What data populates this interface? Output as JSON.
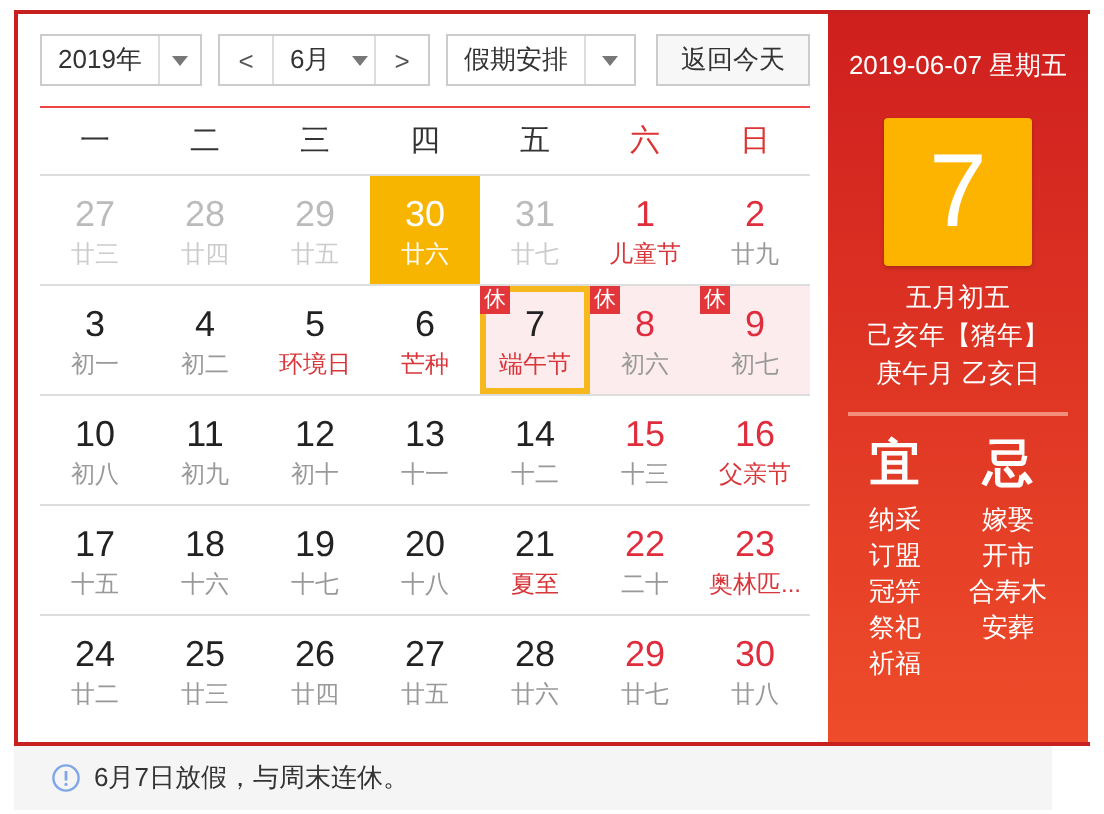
{
  "toolbar": {
    "year": "2019年",
    "prev": "<",
    "month": "6月",
    "next": ">",
    "holiday": "假期安排",
    "today_button": "返回今天"
  },
  "calendar": {
    "weekdays": [
      {
        "label": "一",
        "weekend": false
      },
      {
        "label": "二",
        "weekend": false
      },
      {
        "label": "三",
        "weekend": false
      },
      {
        "label": "四",
        "weekend": false
      },
      {
        "label": "五",
        "weekend": false
      },
      {
        "label": "六",
        "weekend": true
      },
      {
        "label": "日",
        "weekend": true
      }
    ],
    "days": [
      {
        "day": "27",
        "lunar": "廿三",
        "other_month": true,
        "weekend": false,
        "festival": false,
        "highlighted": false,
        "selected": false,
        "rest": false
      },
      {
        "day": "28",
        "lunar": "廿四",
        "other_month": true,
        "weekend": false,
        "festival": false,
        "highlighted": false,
        "selected": false,
        "rest": false
      },
      {
        "day": "29",
        "lunar": "廿五",
        "other_month": true,
        "weekend": false,
        "festival": false,
        "highlighted": false,
        "selected": false,
        "rest": false
      },
      {
        "day": "30",
        "lunar": "廿六",
        "other_month": true,
        "weekend": false,
        "festival": false,
        "highlighted": true,
        "selected": false,
        "rest": false
      },
      {
        "day": "31",
        "lunar": "廿七",
        "other_month": true,
        "weekend": false,
        "festival": false,
        "highlighted": false,
        "selected": false,
        "rest": false
      },
      {
        "day": "1",
        "lunar": "儿童节",
        "other_month": false,
        "weekend": true,
        "festival": true,
        "highlighted": false,
        "selected": false,
        "rest": false
      },
      {
        "day": "2",
        "lunar": "廿九",
        "other_month": false,
        "weekend": true,
        "festival": false,
        "highlighted": false,
        "selected": false,
        "rest": false
      },
      {
        "day": "3",
        "lunar": "初一",
        "other_month": false,
        "weekend": false,
        "festival": false,
        "highlighted": false,
        "selected": false,
        "rest": false
      },
      {
        "day": "4",
        "lunar": "初二",
        "other_month": false,
        "weekend": false,
        "festival": false,
        "highlighted": false,
        "selected": false,
        "rest": false
      },
      {
        "day": "5",
        "lunar": "环境日",
        "other_month": false,
        "weekend": false,
        "festival": true,
        "highlighted": false,
        "selected": false,
        "rest": false
      },
      {
        "day": "6",
        "lunar": "芒种",
        "other_month": false,
        "weekend": false,
        "festival": true,
        "highlighted": false,
        "selected": false,
        "rest": false
      },
      {
        "day": "7",
        "lunar": "端午节",
        "other_month": false,
        "weekend": false,
        "festival": true,
        "highlighted": false,
        "selected": true,
        "rest": true,
        "badge": "休"
      },
      {
        "day": "8",
        "lunar": "初六",
        "other_month": false,
        "weekend": true,
        "festival": false,
        "highlighted": false,
        "selected": false,
        "rest": true,
        "badge": "休"
      },
      {
        "day": "9",
        "lunar": "初七",
        "other_month": false,
        "weekend": true,
        "festival": false,
        "highlighted": false,
        "selected": false,
        "rest": true,
        "badge": "休"
      },
      {
        "day": "10",
        "lunar": "初八",
        "other_month": false,
        "weekend": false,
        "festival": false,
        "highlighted": false,
        "selected": false,
        "rest": false
      },
      {
        "day": "11",
        "lunar": "初九",
        "other_month": false,
        "weekend": false,
        "festival": false,
        "highlighted": false,
        "selected": false,
        "rest": false
      },
      {
        "day": "12",
        "lunar": "初十",
        "other_month": false,
        "weekend": false,
        "festival": false,
        "highlighted": false,
        "selected": false,
        "rest": false
      },
      {
        "day": "13",
        "lunar": "十一",
        "other_month": false,
        "weekend": false,
        "festival": false,
        "highlighted": false,
        "selected": false,
        "rest": false
      },
      {
        "day": "14",
        "lunar": "十二",
        "other_month": false,
        "weekend": false,
        "festival": false,
        "highlighted": false,
        "selected": false,
        "rest": false
      },
      {
        "day": "15",
        "lunar": "十三",
        "other_month": false,
        "weekend": true,
        "festival": false,
        "highlighted": false,
        "selected": false,
        "rest": false
      },
      {
        "day": "16",
        "lunar": "父亲节",
        "other_month": false,
        "weekend": true,
        "festival": true,
        "highlighted": false,
        "selected": false,
        "rest": false
      },
      {
        "day": "17",
        "lunar": "十五",
        "other_month": false,
        "weekend": false,
        "festival": false,
        "highlighted": false,
        "selected": false,
        "rest": false
      },
      {
        "day": "18",
        "lunar": "十六",
        "other_month": false,
        "weekend": false,
        "festival": false,
        "highlighted": false,
        "selected": false,
        "rest": false
      },
      {
        "day": "19",
        "lunar": "十七",
        "other_month": false,
        "weekend": false,
        "festival": false,
        "highlighted": false,
        "selected": false,
        "rest": false
      },
      {
        "day": "20",
        "lunar": "十八",
        "other_month": false,
        "weekend": false,
        "festival": false,
        "highlighted": false,
        "selected": false,
        "rest": false
      },
      {
        "day": "21",
        "lunar": "夏至",
        "other_month": false,
        "weekend": false,
        "festival": true,
        "highlighted": false,
        "selected": false,
        "rest": false
      },
      {
        "day": "22",
        "lunar": "二十",
        "other_month": false,
        "weekend": true,
        "festival": false,
        "highlighted": false,
        "selected": false,
        "rest": false
      },
      {
        "day": "23",
        "lunar": "奥林匹...",
        "other_month": false,
        "weekend": true,
        "festival": true,
        "highlighted": false,
        "selected": false,
        "rest": false
      },
      {
        "day": "24",
        "lunar": "廿二",
        "other_month": false,
        "weekend": false,
        "festival": false,
        "highlighted": false,
        "selected": false,
        "rest": false
      },
      {
        "day": "25",
        "lunar": "廿三",
        "other_month": false,
        "weekend": false,
        "festival": false,
        "highlighted": false,
        "selected": false,
        "rest": false
      },
      {
        "day": "26",
        "lunar": "廿四",
        "other_month": false,
        "weekend": false,
        "festival": false,
        "highlighted": false,
        "selected": false,
        "rest": false
      },
      {
        "day": "27",
        "lunar": "廿五",
        "other_month": false,
        "weekend": false,
        "festival": false,
        "highlighted": false,
        "selected": false,
        "rest": false
      },
      {
        "day": "28",
        "lunar": "廿六",
        "other_month": false,
        "weekend": false,
        "festival": false,
        "highlighted": false,
        "selected": false,
        "rest": false
      },
      {
        "day": "29",
        "lunar": "廿七",
        "other_month": false,
        "weekend": true,
        "festival": false,
        "highlighted": false,
        "selected": false,
        "rest": false
      },
      {
        "day": "30",
        "lunar": "廿八",
        "other_month": false,
        "weekend": true,
        "festival": false,
        "highlighted": false,
        "selected": false,
        "rest": false
      }
    ]
  },
  "panel": {
    "date_line": "2019-06-07 星期五",
    "big_day": "7",
    "lunar_lines": [
      "五月初五",
      "己亥年【猪年】",
      "庚午月 乙亥日"
    ],
    "good": {
      "title": "宜",
      "items": [
        "纳采",
        "订盟",
        "冠笄",
        "祭祀",
        "祈福"
      ]
    },
    "bad": {
      "title": "忌",
      "items": [
        "嫁娶",
        "开市",
        "合寿木",
        "安葬"
      ]
    }
  },
  "note": {
    "text": "6月7日放假，与周末连休。"
  }
}
